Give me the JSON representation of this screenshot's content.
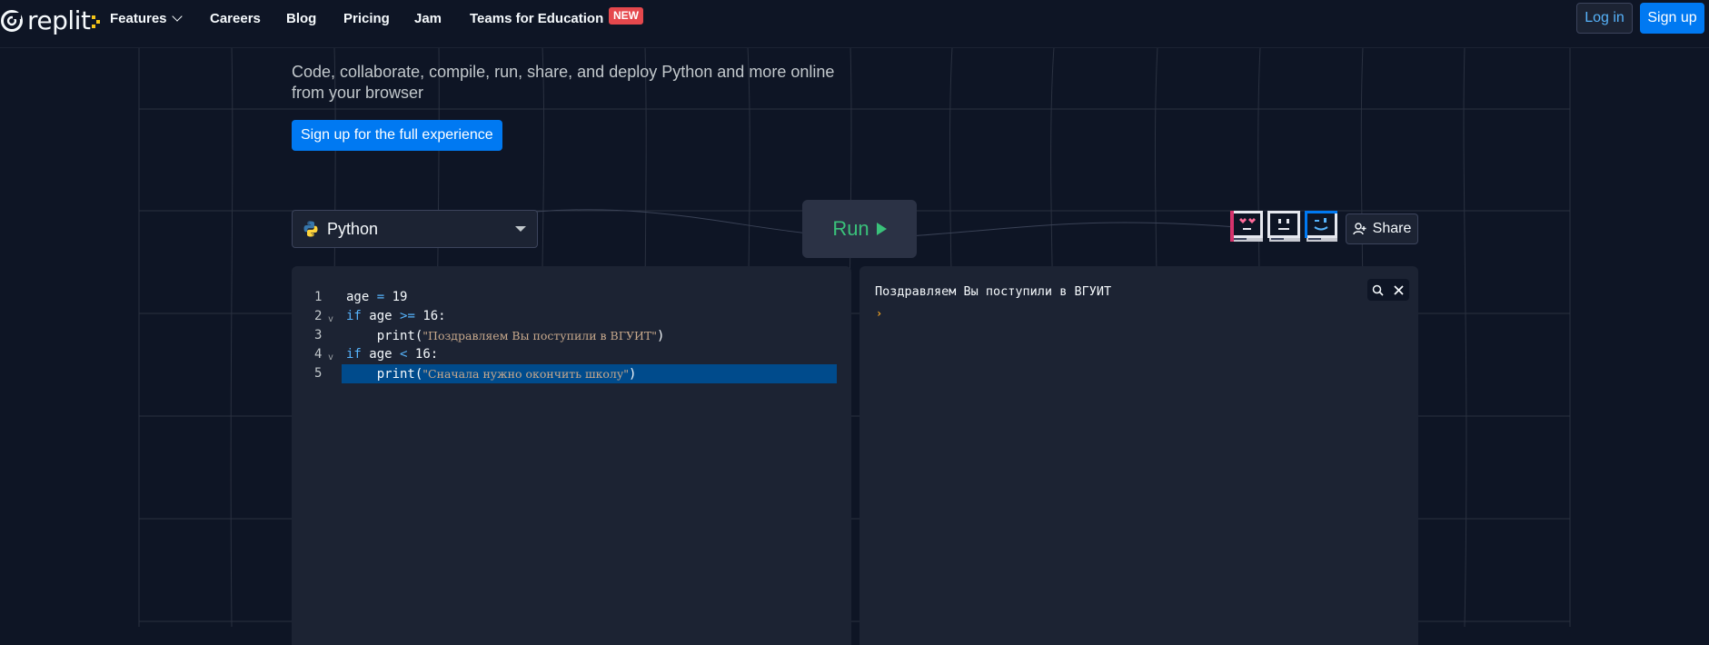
{
  "nav": {
    "logo_text": "replit",
    "items": [
      {
        "label": "Features",
        "has_dropdown": true
      },
      {
        "label": "Careers"
      },
      {
        "label": "Blog"
      },
      {
        "label": "Pricing"
      },
      {
        "label": "Jam"
      },
      {
        "label": "Teams for Education"
      }
    ],
    "new_badge": "NEW",
    "login_label": "Log in",
    "signup_label": "Sign up"
  },
  "hero": {
    "subtitle": "Code, collaborate, compile, run, share, and deploy Python and more online from your browser",
    "cta_label": "Sign up for the full experience"
  },
  "controls": {
    "language": "Python",
    "run_label": "Run",
    "share_label": "Share",
    "avatars": [
      "heart-eyes-avatar-icon",
      "neutral-face-avatar-icon",
      "wink-face-avatar-icon"
    ]
  },
  "editor": {
    "active_line": 5,
    "lines": [
      {
        "n": "1",
        "fold": false
      },
      {
        "n": "2",
        "fold": true
      },
      {
        "n": "3",
        "fold": false
      },
      {
        "n": "4",
        "fold": true
      },
      {
        "n": "5",
        "fold": false
      }
    ],
    "tokens": {
      "l1_var": "age",
      "l1_op": "=",
      "l1_num": "19",
      "l2_kw": "if",
      "l2_var": "age",
      "l2_op": ">=",
      "l2_num": "16:",
      "l3_fn": "print(",
      "l3_str": "\"Поздравляем Вы поступили в ВГУИТ\"",
      "l3_close": ")",
      "l4_kw": "if",
      "l4_var": "age",
      "l4_op": "<",
      "l4_num": "16:",
      "l5_fn": "print(",
      "l5_str": "\"Сначала нужно окончить школу\"",
      "l5_close": ")"
    }
  },
  "console": {
    "output": "Поздравляем Вы поступили в ВГУИТ",
    "prompt": "›"
  },
  "colors": {
    "background": "#0e1525",
    "panel": "#1c2333",
    "accent_blue": "#0079f2",
    "run_green": "#3ac17a",
    "badge_red": "#e5484d"
  }
}
